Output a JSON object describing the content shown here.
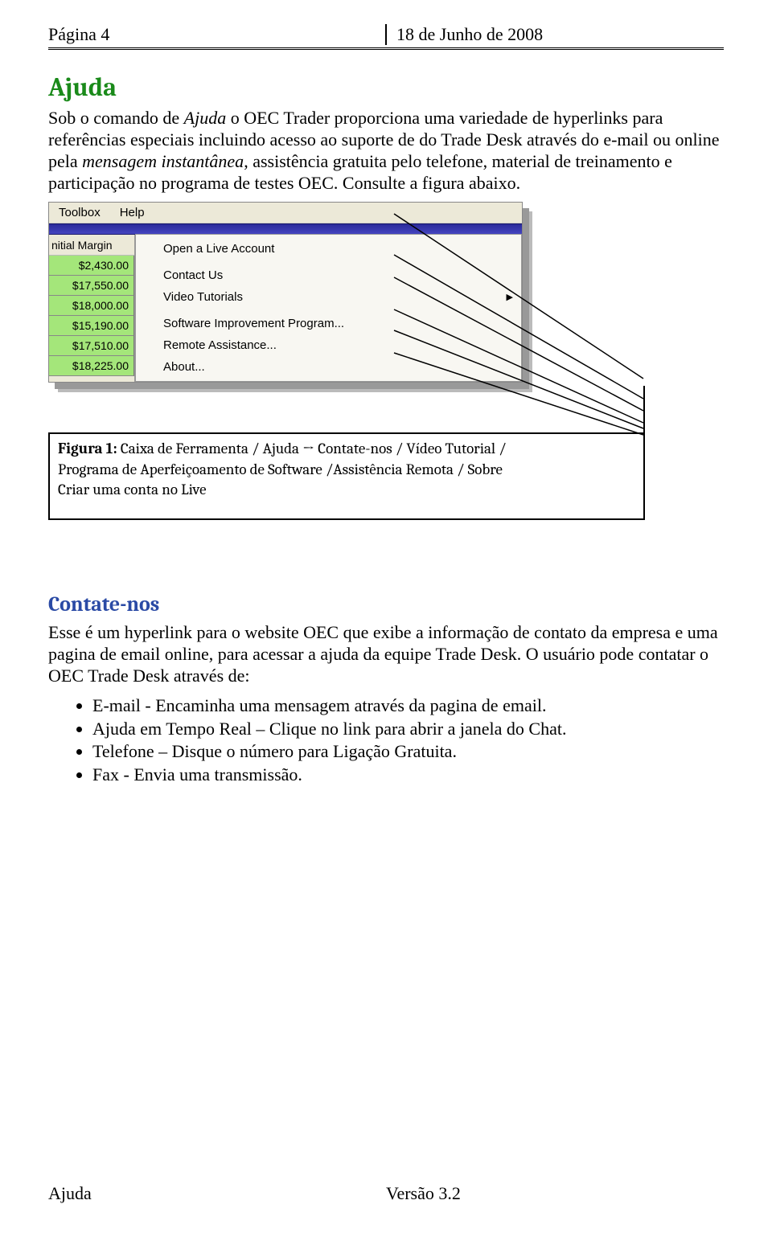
{
  "header": {
    "left": "Página 4",
    "right": "18 de Junho de 2008"
  },
  "sections": {
    "ajuda": {
      "title": "Ajuda",
      "body": "Sob o comando de Ajuda o OEC Trader proporciona uma variedade de hyperlinks para referências especiais incluindo acesso ao suporte de do Trade Desk através do e-mail ou online pela mensagem instantânea, assistência gratuita pelo telefone, material de treinamento e participação no programa de testes OEC. Consulte a figura abaixo."
    },
    "contate": {
      "title": "Contate-nos",
      "body": "Esse é um hyperlink para o website OEC que exibe a informação de contato da empresa e uma pagina de email online, para acessar a ajuda da equipe Trade Desk. O usuário pode contatar o OEC Trade Desk através de:",
      "bullets": [
        "E-mail - Encaminha uma mensagem através da pagina de email.",
        "Ajuda em Tempo Real – Clique no link para abrir a janela do Chat.",
        "Telefone – Disque o número para Ligação Gratuita.",
        "Fax - Envia uma transmissão."
      ]
    }
  },
  "screenshot": {
    "menubar": {
      "toolbox": "Toolbox",
      "help": "Help"
    },
    "leftcol": {
      "header": "nitial Margin",
      "cells": [
        "$2,430.00",
        "$17,550.00",
        "$18,000.00",
        "$15,190.00",
        "$17,510.00",
        "$18,225.00"
      ]
    },
    "dropdown": [
      "Open a Live Account",
      "Contact Us",
      "Video Tutorials",
      "Software Improvement Program...",
      "Remote Assistance...",
      "About..."
    ]
  },
  "figure": {
    "label": "Figura 1:",
    "line1": " Caixa de Ferramenta / Ajuda → Contate-nos / Vídeo Tutorial /",
    "line2": "Programa de Aperfeiçoamento de Software /Assistência Remota / Sobre",
    "line3": "Criar uma conta no Live"
  },
  "footer": {
    "left": "Ajuda",
    "center": "Versão 3.2"
  }
}
